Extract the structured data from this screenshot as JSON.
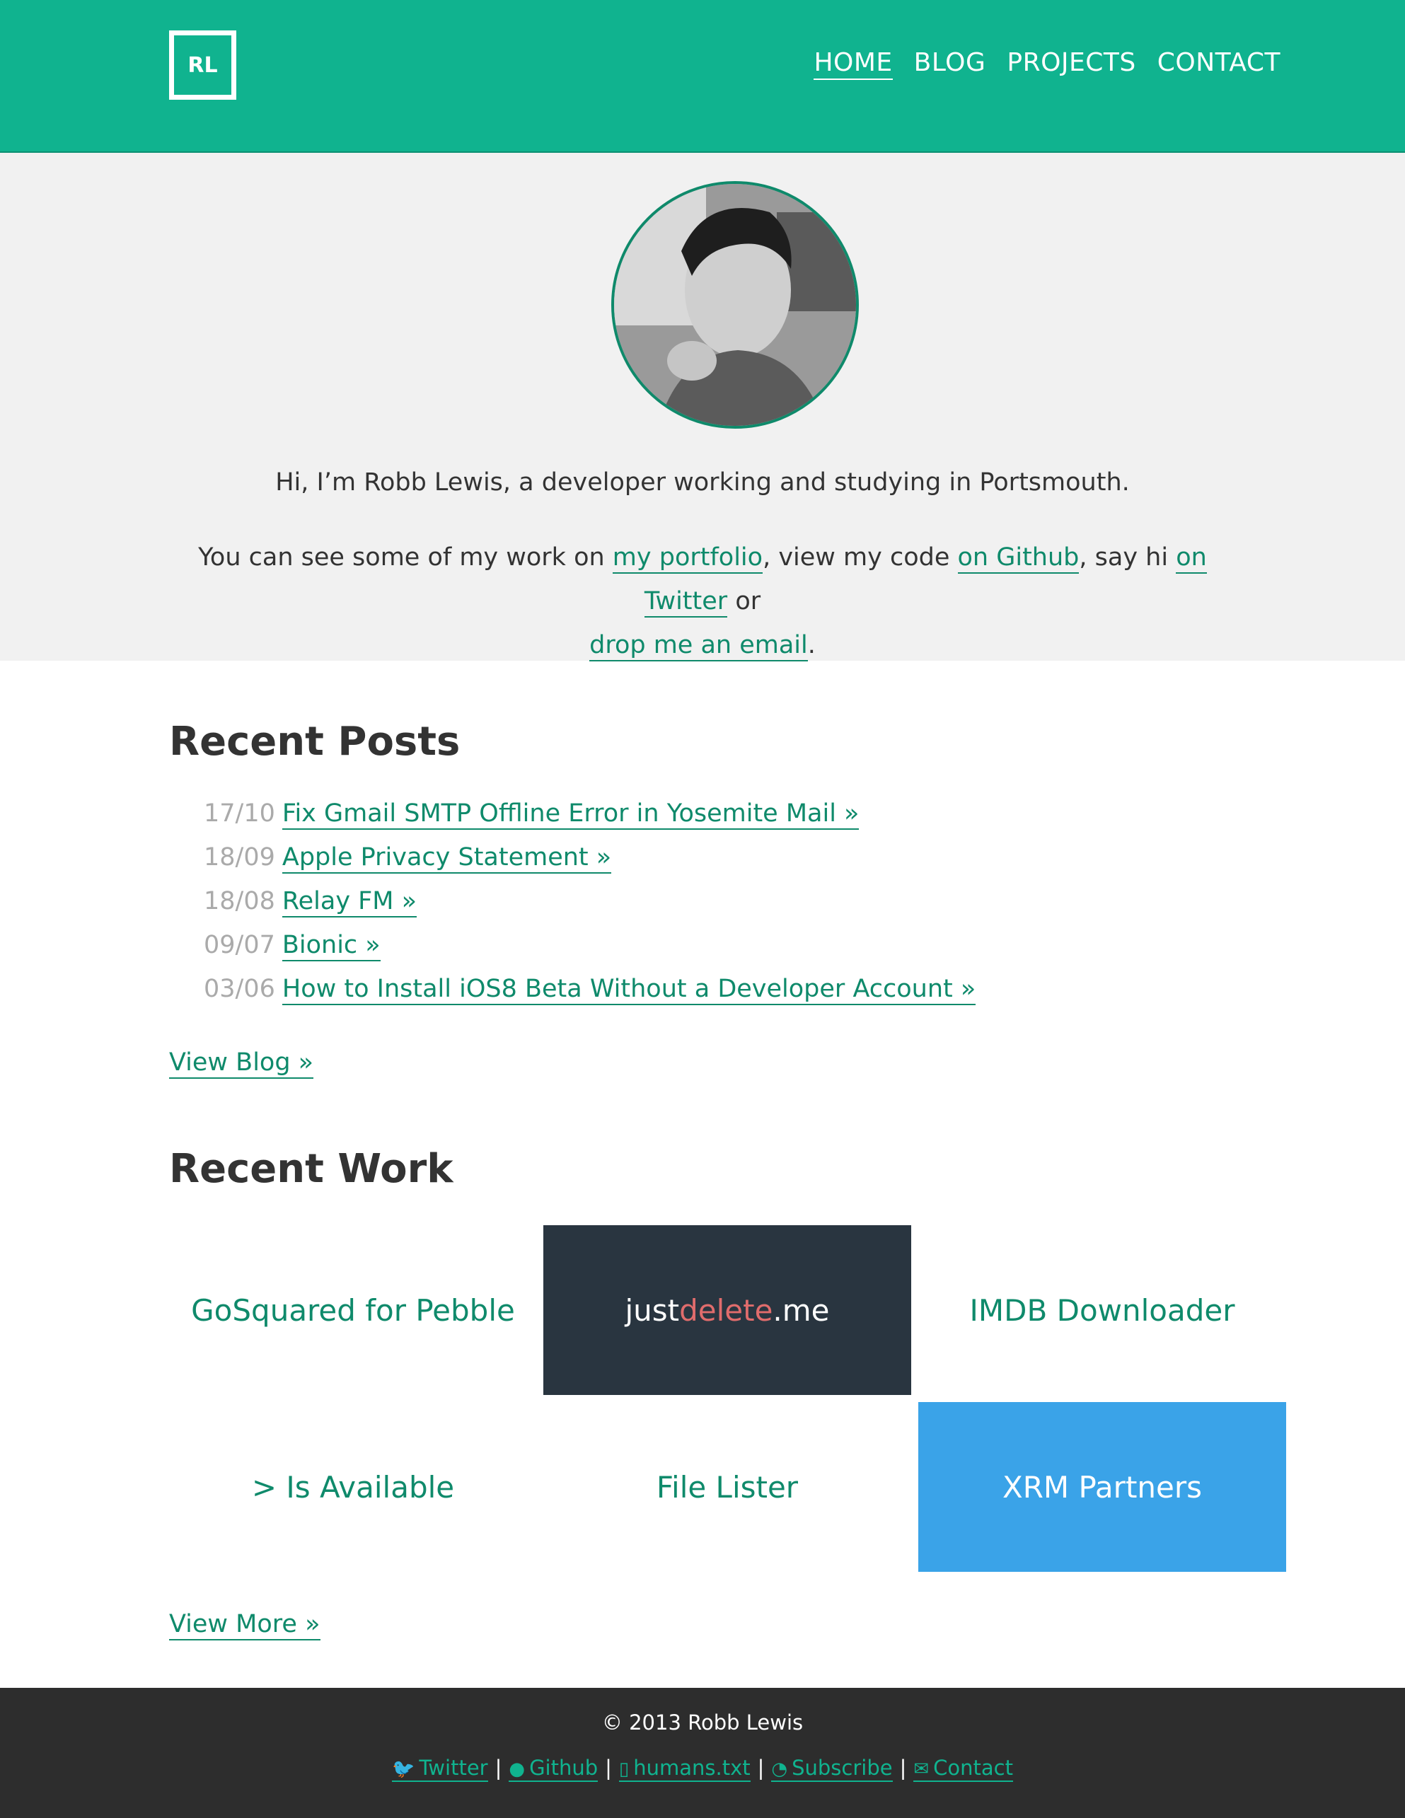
{
  "header": {
    "logo": "RL",
    "nav": [
      {
        "label": "HOME",
        "active": true
      },
      {
        "label": "BLOG"
      },
      {
        "label": "PROJECTS"
      },
      {
        "label": "CONTACT"
      }
    ]
  },
  "hero": {
    "intro": "Hi, I’m Robb Lewis, a developer working and studying in Portsmouth.",
    "links_text_1": "You can see some of my work on ",
    "link_portfolio": "my portfolio",
    "links_text_2": ", view my code ",
    "link_github": "on Github",
    "links_text_3": ", say hi ",
    "link_twitter": "on Twitter",
    "links_text_4": " or",
    "link_email": "drop me an email",
    "links_text_5": "."
  },
  "posts": {
    "title": "Recent Posts",
    "items": [
      {
        "date": "17/10",
        "title": "Fix Gmail SMTP Offline Error in Yosemite Mail »"
      },
      {
        "date": "18/09",
        "title": "Apple Privacy Statement »"
      },
      {
        "date": "18/08",
        "title": "Relay FM »"
      },
      {
        "date": "09/07",
        "title": "Bionic »"
      },
      {
        "date": "03/06",
        "title": "How to Install iOS8 Beta Without a Developer Account »"
      }
    ],
    "view_blog": "View Blog »"
  },
  "work": {
    "title": "Recent Work",
    "tiles": [
      {
        "label": "GoSquared for Pebble"
      },
      {
        "label_a": "just",
        "label_b": "delete",
        "label_c": ".me"
      },
      {
        "label": "IMDB Downloader"
      },
      {
        "label": "> Is Available"
      },
      {
        "label": "File Lister"
      },
      {
        "label": "XRM Partners"
      }
    ],
    "view_more": "View More »"
  },
  "footer": {
    "copyright": "© 2013 Robb Lewis",
    "links": [
      "Twitter",
      "Github",
      "humans.txt",
      "Subscribe",
      "Contact"
    ]
  },
  "colors": {
    "brand": "#10b38f",
    "link": "#0f8a6b",
    "justdelete_bg": "#293540",
    "xrm_bg": "#3aa3e8",
    "footer_bg": "#2d2d2d"
  }
}
